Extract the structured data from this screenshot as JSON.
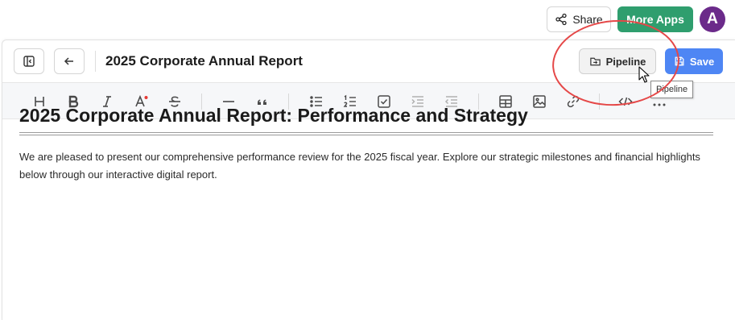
{
  "topbar": {
    "share_label": "Share",
    "more_apps_label": "More Apps",
    "avatar_initial": "A"
  },
  "editor": {
    "doc_title": "2025 Corporate Annual Report",
    "pipeline_label": "Pipeline",
    "save_label": "Save",
    "tooltip_text": "Pipeline"
  },
  "toolbar": {
    "icons": [
      "heading-icon",
      "bold-icon",
      "italic-icon",
      "text-color-icon",
      "strikethrough-icon",
      "horizontal-rule-icon",
      "quote-icon",
      "bullet-list-icon",
      "ordered-list-icon",
      "checklist-icon",
      "indent-icon",
      "outdent-icon",
      "table-icon",
      "image-icon",
      "link-icon",
      "code-icon",
      "more-icon"
    ]
  },
  "document": {
    "heading": "2025 Corporate Annual Report: Performance and Strategy",
    "paragraph": "We are pleased to present our comprehensive performance review for the 2025 fiscal year. Explore our strategic milestones and financial highlights below through our interactive digital report."
  },
  "colors": {
    "more_apps": "#2f9e6e",
    "avatar": "#6b2a8a",
    "save": "#4e86f4",
    "annotation": "#e54848"
  }
}
